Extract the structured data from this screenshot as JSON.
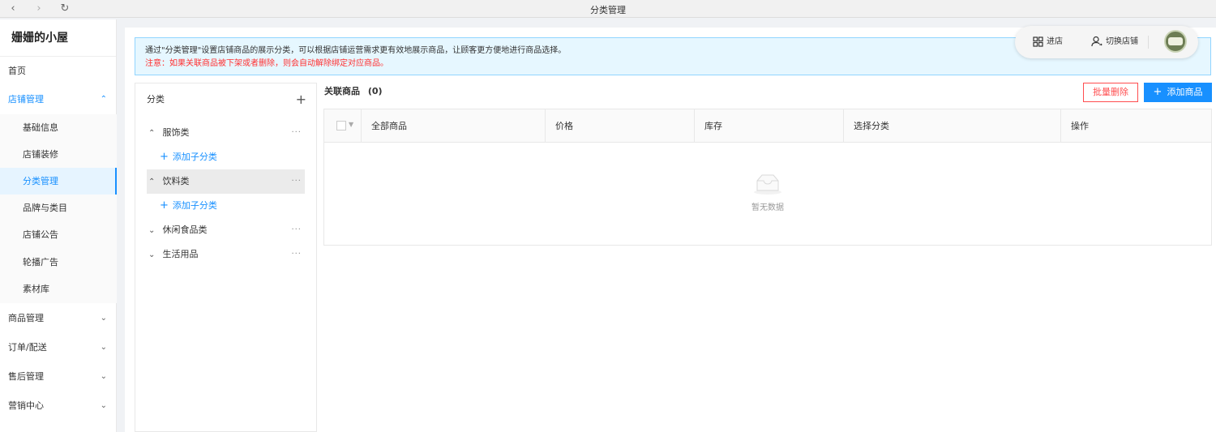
{
  "window": {
    "title": "分类管理"
  },
  "browser": {
    "back_icon": "arrow-left-icon",
    "forward_icon": "arrow-right-icon",
    "reload_icon": "reload-icon"
  },
  "sidebar": {
    "brand": "姗姗的小屋",
    "home": "首页",
    "store": "店铺管理",
    "store_items": [
      "基础信息",
      "店铺装修",
      "分类管理",
      "品牌与类目",
      "店铺公告",
      "轮播广告",
      "素材库"
    ],
    "active_item": "分类管理",
    "product": "商品管理",
    "orders": "订单/配送",
    "aftersale": "售后管理",
    "marketing": "营销中心"
  },
  "header": {
    "enter_store": "进店",
    "switch_store": "切换店铺"
  },
  "notice": {
    "line1": "通过\"分类管理\"设置店铺商品的展示分类，可以根据店铺运营需求更有效地展示商品，让顾客更方便地进行商品选择。",
    "line2": "注意：如果关联商品被下架或者删除，则会自动解除绑定对应商品。"
  },
  "categories": {
    "header": "分类",
    "add_sub_label": "添加子分类",
    "items": [
      {
        "name": "服饰类",
        "expanded": true
      },
      {
        "name": "饮料类",
        "expanded": true,
        "selected": true
      },
      {
        "name": "休闲食品类",
        "expanded": false
      },
      {
        "name": "生活用品",
        "expanded": false
      }
    ]
  },
  "products": {
    "title": "关联商品",
    "count": "(0)",
    "batch_delete": "批量删除",
    "add_product": "添加商品",
    "columns": [
      "全部商品",
      "价格",
      "库存",
      "选择分类",
      "操作"
    ],
    "empty_text": "暂无数据"
  },
  "colors": {
    "primary": "#1890ff",
    "danger": "#ff4d4f",
    "notice_bg": "#e6f7ff",
    "notice_warn": "#ff3030"
  }
}
